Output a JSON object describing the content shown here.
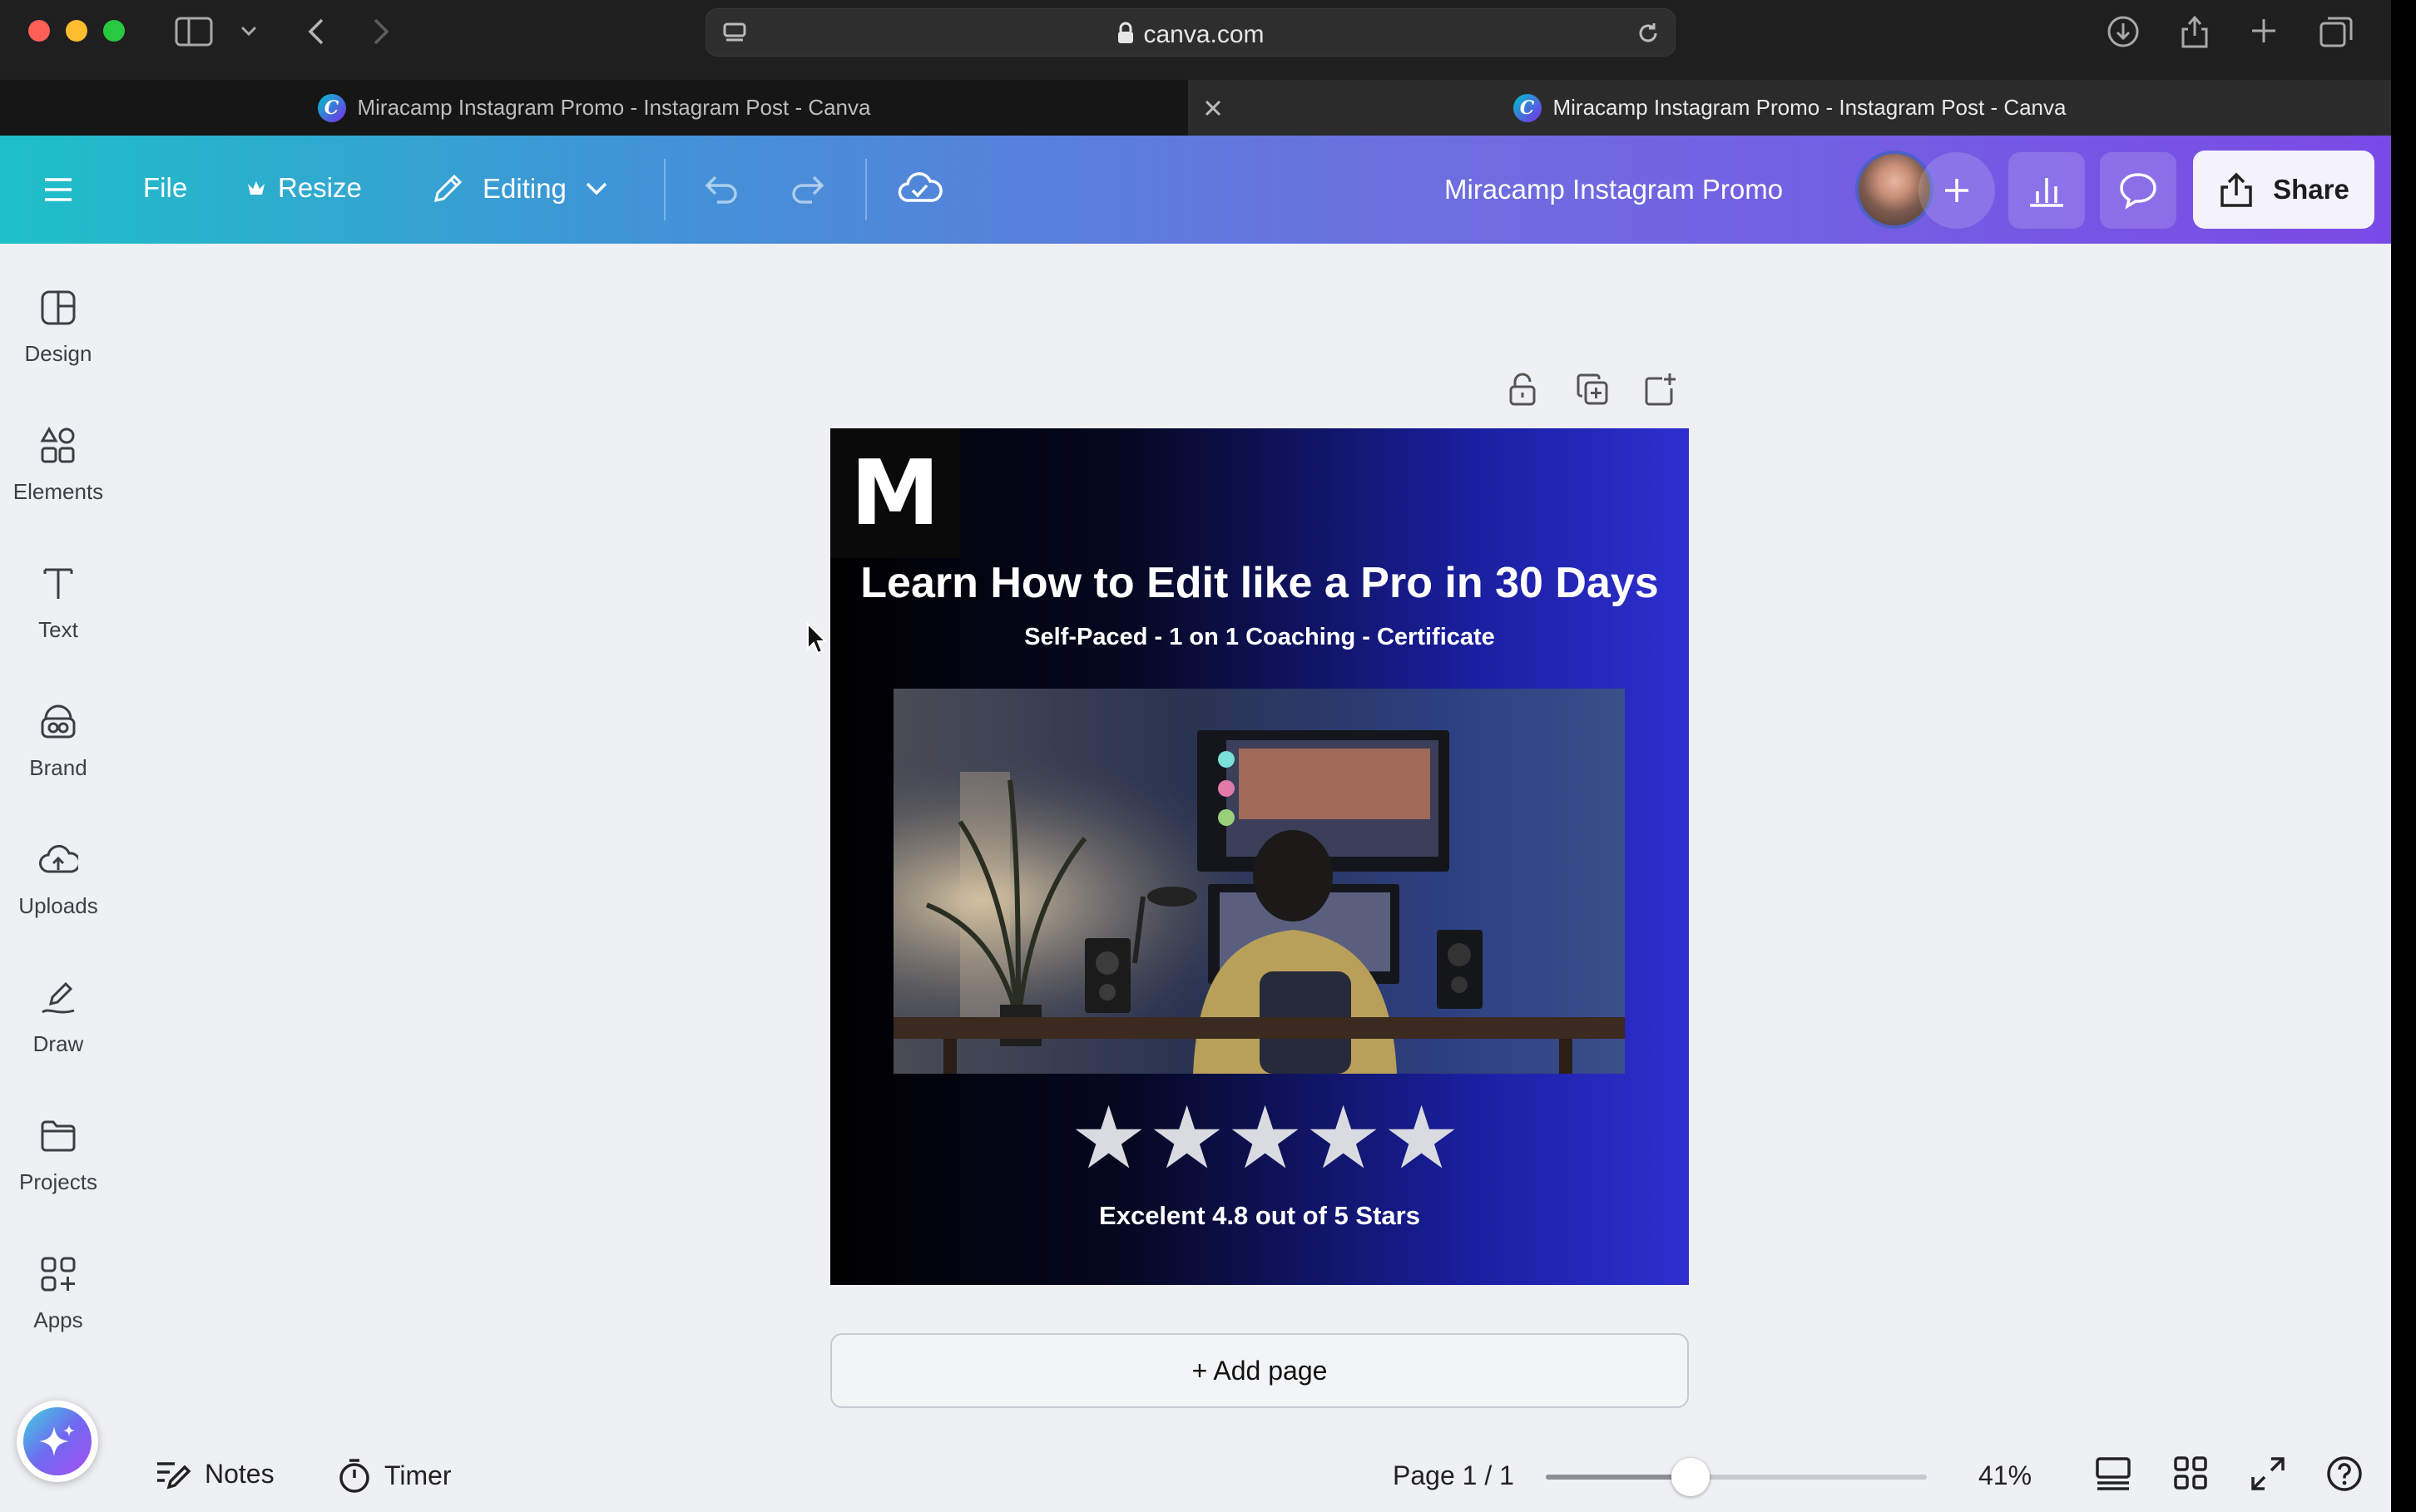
{
  "browser": {
    "url": "canva.com",
    "tabs": [
      {
        "title": "Miracamp Instagram Promo - Instagram Post - Canva"
      },
      {
        "title": "Miracamp Instagram Promo - Instagram Post - Canva"
      }
    ],
    "tab_favicon_letter": "C"
  },
  "header": {
    "file_label": "File",
    "resize_label": "Resize",
    "editing_label": "Editing",
    "doc_title": "Miracamp Instagram Promo",
    "share_label": "Share"
  },
  "sidebar": {
    "items": [
      {
        "label": "Design",
        "icon": "design-icon"
      },
      {
        "label": "Elements",
        "icon": "elements-icon"
      },
      {
        "label": "Text",
        "icon": "text-icon"
      },
      {
        "label": "Brand",
        "icon": "brand-icon"
      },
      {
        "label": "Uploads",
        "icon": "uploads-icon"
      },
      {
        "label": "Draw",
        "icon": "draw-icon"
      },
      {
        "label": "Projects",
        "icon": "projects-icon"
      },
      {
        "label": "Apps",
        "icon": "apps-icon"
      }
    ]
  },
  "design": {
    "logo_letter": "M",
    "headline": "Learn How to Edit like a Pro in 30 Days",
    "subline": "Self-Paced - 1 on 1 Coaching - Certificate",
    "stars": 5,
    "star_glyph": "★",
    "rating_text": "Excelent 4.8 out of 5 Stars"
  },
  "canvas": {
    "add_page_label": "+ Add page"
  },
  "footer": {
    "notes_label": "Notes",
    "timer_label": "Timer",
    "page_indicator": "Page 1 / 1",
    "zoom_label": "41%",
    "zoom_fraction": 0.38
  },
  "colors": {
    "header_start": "#1ec0c8",
    "header_end": "#7a4ae6",
    "design_bg": "#2f2fd0"
  }
}
